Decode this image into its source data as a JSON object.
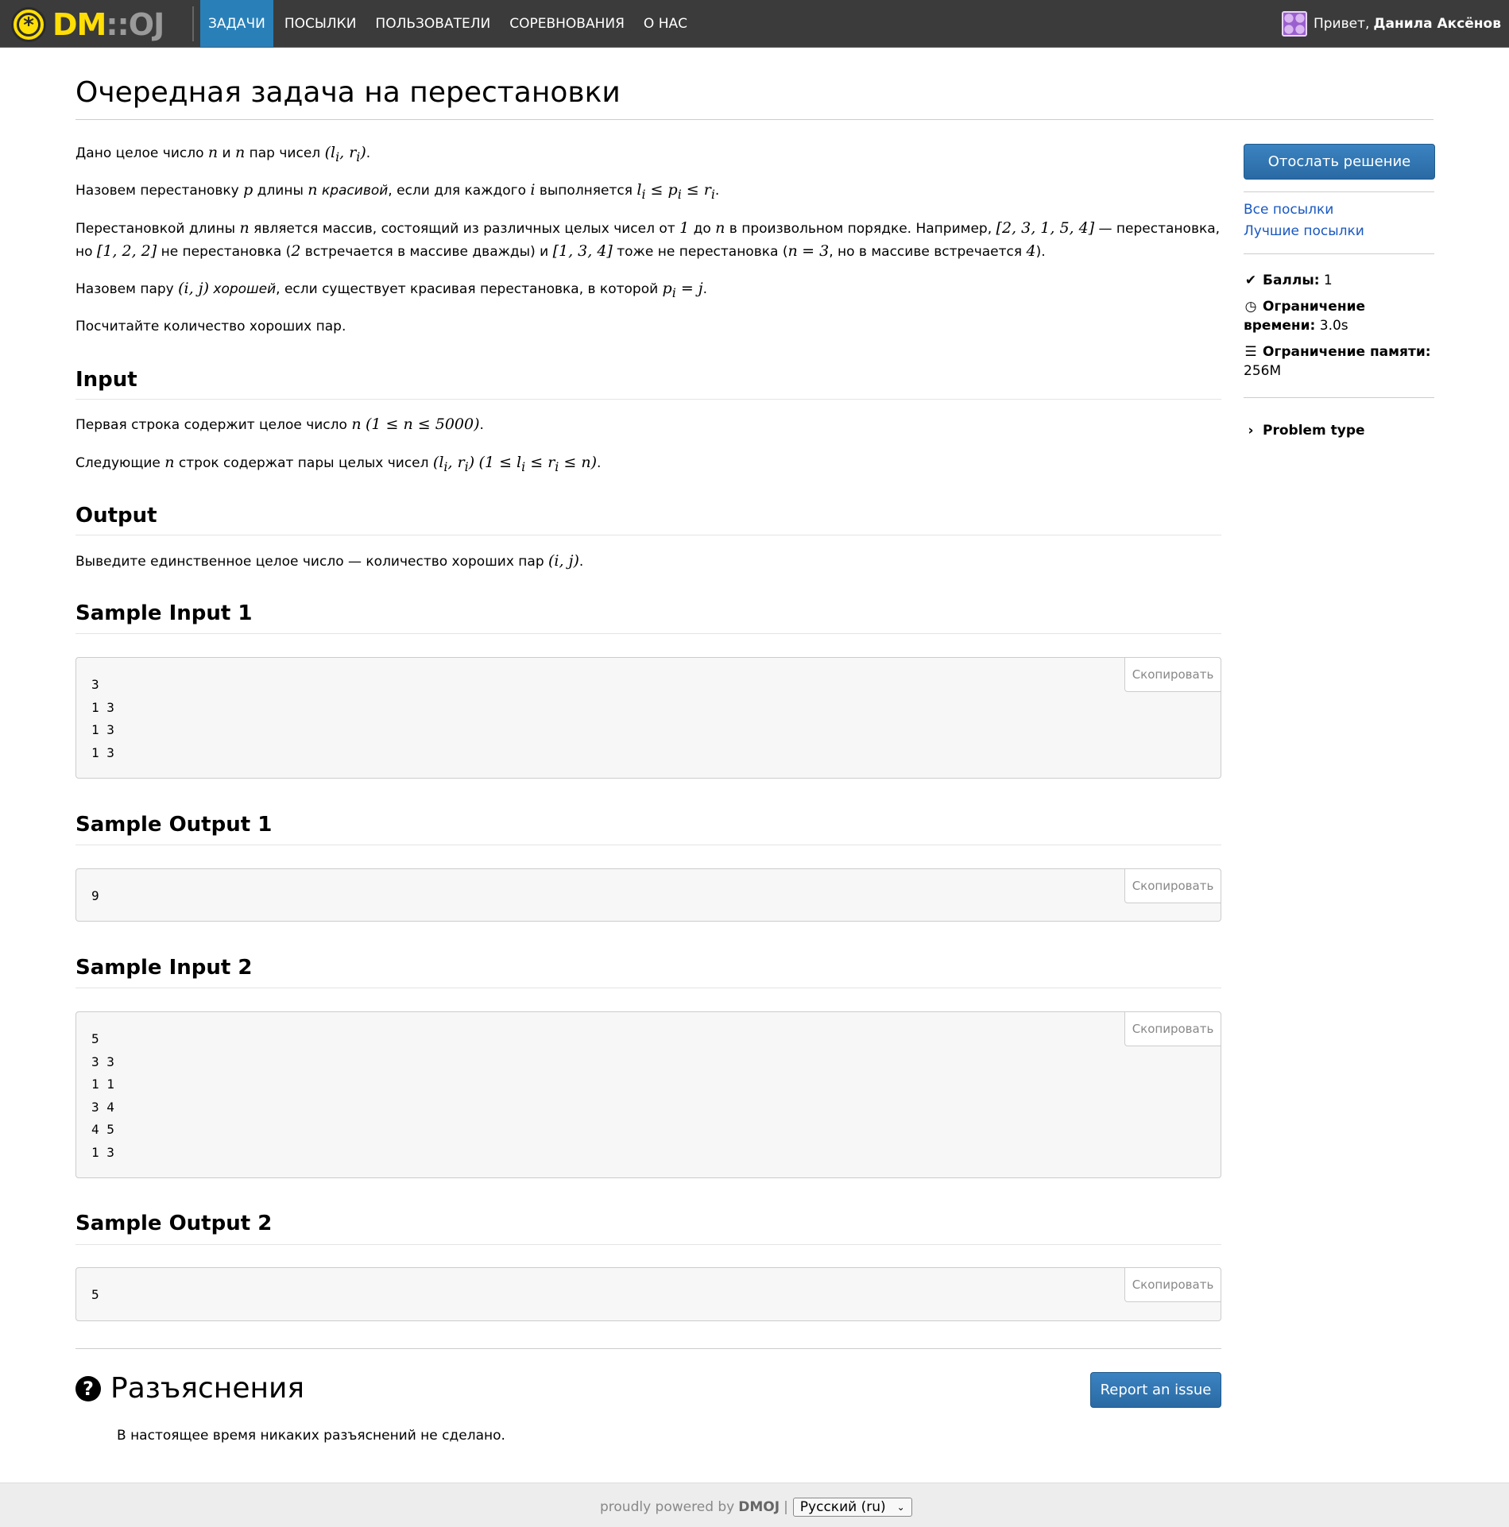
{
  "nav": {
    "logo_dm": "DM",
    "logo_sep": "::",
    "logo_oj": "OJ",
    "items": [
      {
        "label": "Задачи",
        "active": true
      },
      {
        "label": "Посылки",
        "active": false
      },
      {
        "label": "Пользователи",
        "active": false
      },
      {
        "label": "Соревнования",
        "active": false
      },
      {
        "label": "О нас",
        "active": false
      }
    ],
    "greeting": "Привет,",
    "user_name": "Данила Аксёнов"
  },
  "problem": {
    "title": "Очередная задача на перестановки",
    "statement": [
      "Дано целое число n и n пар чисел (l_i, r_i).",
      "Назовем перестановку p длины n красивой, если для каждого i выполняется l_i ≤ p_i ≤ r_i.",
      "Перестановкой длины n является массив, состоящий из различных целых чисел от 1 до n в произвольном порядке. Например, [2,3,1,5,4] — перестановка, но [1,2,2] не перестановка (2 встречается в массиве дважды) и [1,3,4] тоже не перестановка (n=3, но в массиве встречается 4).",
      "Назовем пару (i, j) хорошей, если существует красивая перестановка, в которой p_i = j.",
      "Посчитайте количество хороших пар."
    ],
    "input_heading": "Input",
    "input_text": [
      "Первая строка содержит целое число n (1 ≤ n ≤ 5000).",
      "Следующие n строк содержат пары целых чисел (l_i, r_i) (1 ≤ l_i ≤ r_i ≤ n)."
    ],
    "output_heading": "Output",
    "output_text": "Выведите единственное целое число — количество хороших пар (i, j).",
    "samples": [
      {
        "heading": "Sample Input 1",
        "lines": [
          "3",
          "1 3",
          "1 3",
          "1 3"
        ]
      },
      {
        "heading": "Sample Output 1",
        "lines": [
          "9"
        ]
      },
      {
        "heading": "Sample Input 2",
        "lines": [
          "5",
          "3 3",
          "1 1",
          "3 4",
          "4 5",
          "1 3"
        ]
      },
      {
        "heading": "Sample Output 2",
        "lines": [
          "5"
        ]
      }
    ],
    "copy_label": "Скопировать"
  },
  "clarifications": {
    "title": "Разъяснения",
    "text": "В настоящее время никаких разъяснений не сделано.",
    "report_label": "Report an issue"
  },
  "sidebar": {
    "submit_label": "Отослать решение",
    "all_submissions": "Все посылки",
    "best_submissions": "Лучшие посылки",
    "points_label": "Баллы:",
    "points_value": "1",
    "time_label": "Ограничение времени:",
    "time_value": "3.0s",
    "memory_label": "Ограничение памяти:",
    "memory_value": "256M",
    "problem_type": "Problem type"
  },
  "footer": {
    "powered": "proudly powered by",
    "brand": "DMOJ",
    "sep": "|",
    "language": "Русский (ru)"
  },
  "colors": {
    "navbar": "#3b3b3b",
    "nav_active": "#2980b9",
    "logo_yellow": "#ffde05",
    "button_blue": "#296eaa",
    "link_blue": "#1958c1"
  }
}
